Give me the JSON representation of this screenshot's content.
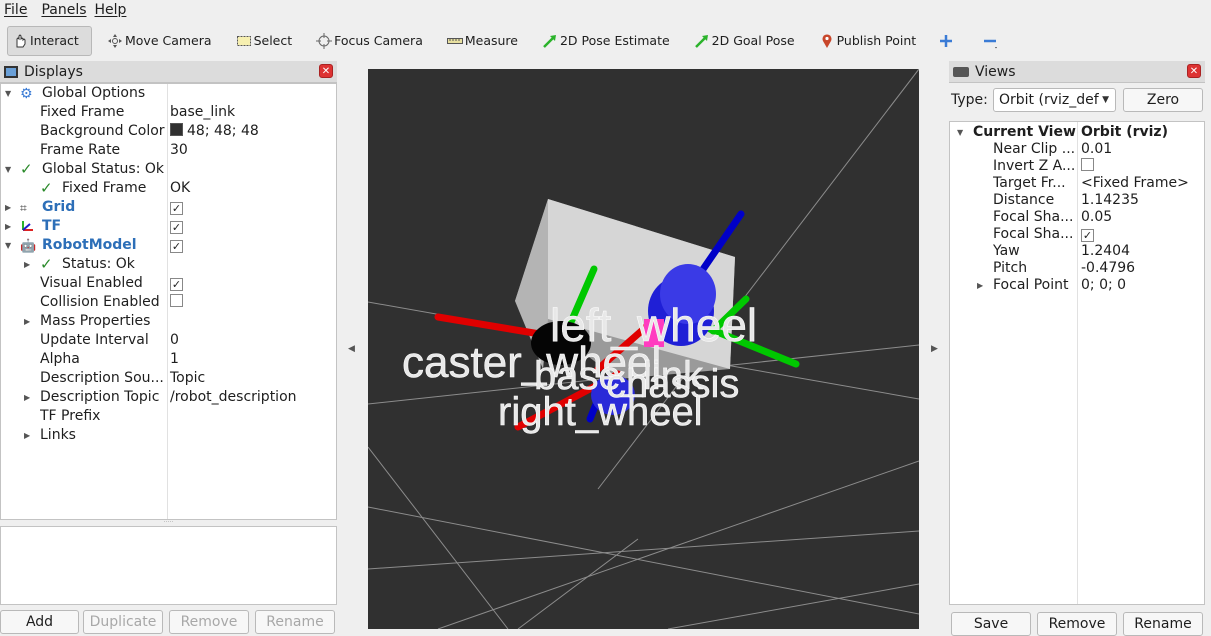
{
  "menu": [
    {
      "label": "File"
    },
    {
      "label": "Panels"
    },
    {
      "label": "Help"
    }
  ],
  "toolbar": {
    "tools": [
      {
        "label": "Interact",
        "icon": "hand-icon",
        "active": true
      },
      {
        "label": "Move Camera",
        "icon": "move-camera-icon"
      },
      {
        "label": "Select",
        "icon": "select-rect-icon"
      },
      {
        "label": "Focus Camera",
        "icon": "focus-camera-icon"
      },
      {
        "label": "Measure",
        "icon": "ruler-icon"
      },
      {
        "label": "2D Pose Estimate",
        "icon": "green-arrow-icon"
      },
      {
        "label": "2D Goal Pose",
        "icon": "green-arrow-icon"
      },
      {
        "label": "Publish Point",
        "icon": "map-pin-icon"
      }
    ],
    "plus_icon": "plus-icon",
    "minus_icon": "minus-icon"
  },
  "displays": {
    "title": "Displays",
    "rows": [
      {
        "label": "Global Options",
        "value": ""
      },
      {
        "label": "Fixed Frame",
        "value": "base_link"
      },
      {
        "label": "Background Color",
        "value": "48; 48; 48"
      },
      {
        "label": "Frame Rate",
        "value": "30"
      },
      {
        "label": "Global Status: Ok",
        "value": ""
      },
      {
        "label": "Fixed Frame",
        "value": "OK"
      },
      {
        "label": "Grid",
        "value": ""
      },
      {
        "label": "TF",
        "value": ""
      },
      {
        "label": "RobotModel",
        "value": ""
      },
      {
        "label": "Status: Ok",
        "value": ""
      },
      {
        "label": "Visual Enabled",
        "value": ""
      },
      {
        "label": "Collision Enabled",
        "value": ""
      },
      {
        "label": "Mass Properties",
        "value": ""
      },
      {
        "label": "Update Interval",
        "value": "0"
      },
      {
        "label": "Alpha",
        "value": "1"
      },
      {
        "label": "Description Sou...",
        "value": "Topic"
      },
      {
        "label": "Description Topic",
        "value": "/robot_description"
      },
      {
        "label": "TF Prefix",
        "value": ""
      },
      {
        "label": "Links",
        "value": ""
      }
    ],
    "background_color_hex": "#303030",
    "buttons": {
      "add": "Add",
      "duplicate": "Duplicate",
      "remove": "Remove",
      "rename": "Rename"
    }
  },
  "viewport": {
    "labels": {
      "left_wheel": "left_wheel",
      "caster_wheel": "caster_wheel",
      "base_link": "base_link",
      "chassis": "chassis",
      "right_wheel": "right_wheel"
    }
  },
  "views": {
    "title": "Views",
    "type_label": "Type:",
    "type_value": "Orbit (rviz_def",
    "zero_button": "Zero",
    "rows": [
      {
        "label": "Current View",
        "value": "Orbit (rviz)"
      },
      {
        "label": "Near Clip ...",
        "value": "0.01"
      },
      {
        "label": "Invert Z A...",
        "value": ""
      },
      {
        "label": "Target Fr...",
        "value": "<Fixed Frame>"
      },
      {
        "label": "Distance",
        "value": "1.14235"
      },
      {
        "label": "Focal Sha...",
        "value": "0.05"
      },
      {
        "label": "Focal Sha...",
        "value": ""
      },
      {
        "label": "Yaw",
        "value": "1.2404"
      },
      {
        "label": "Pitch",
        "value": "-0.4796"
      },
      {
        "label": "Focal Point",
        "value": "0; 0; 0"
      }
    ],
    "buttons": {
      "save": "Save",
      "remove": "Remove",
      "rename": "Rename"
    }
  }
}
